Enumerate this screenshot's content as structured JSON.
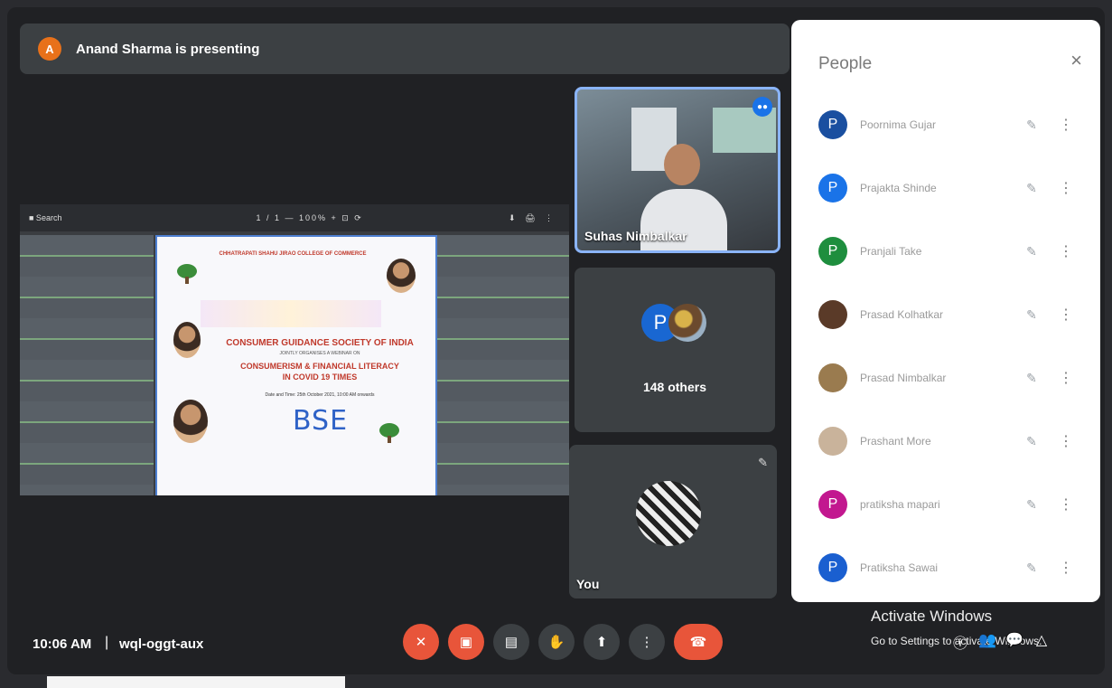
{
  "presenting": {
    "avatar_letter": "A",
    "text": "Anand Sharma is presenting"
  },
  "viewer_toolbar": {
    "left": "■  Search",
    "mid": "1 / 1  —  100%  +  ⊡  ⟳",
    "right": "⬇  🖨  ⋮"
  },
  "poster": {
    "college": "CHHATRAPATI SHAHU JIRAO COLLEGE OF COMMERCE",
    "society": "CONSUMER GUIDANCE SOCIETY OF INDIA",
    "organises": "JOINTLY ORGANISES A WEBINAR ON",
    "topic_line1": "CONSUMERISM & FINANCIAL LITERACY",
    "topic_line2": "IN COVID 19 TIMES",
    "datetime": "Date and Time: 25th October 2021, 10:00 AM onwards",
    "logo": "BSE"
  },
  "tiles": {
    "featured": {
      "name": "Suhas Nimbalkar",
      "display_name": "Suhas Nimbalkar"
    },
    "others": {
      "avatar_letter": "P",
      "count_label": "148 others"
    },
    "self": {
      "label": "You"
    }
  },
  "people_panel": {
    "title": "People",
    "close_icon": "×",
    "people": [
      {
        "name": "Poornima Gujar",
        "avatar_letter": "P",
        "avatar_color": "#1a4fa0"
      },
      {
        "name": "Prajakta Shinde",
        "avatar_letter": "P",
        "avatar_color": "#1a73e8"
      },
      {
        "name": "Pranjali Take",
        "avatar_letter": "P",
        "avatar_color": "#1e8e3e"
      },
      {
        "name": "Prasad Kolhatkar",
        "avatar_letter": "",
        "avatar_color": "#5a3a28"
      },
      {
        "name": "Prasad Nimbalkar",
        "avatar_letter": "",
        "avatar_color": "#9a7b4f"
      },
      {
        "name": "Prashant More",
        "avatar_letter": "",
        "avatar_color": "#c9b39b"
      },
      {
        "name": "pratiksha mapari",
        "avatar_letter": "P",
        "avatar_color": "#c2188f"
      },
      {
        "name": "Pratiksha Sawai",
        "avatar_letter": "P",
        "avatar_color": "#1a5fd0"
      }
    ]
  },
  "bottom_bar": {
    "time": "10:06 AM",
    "separator": "|",
    "meeting_code": "wql-oggt-aux",
    "controls": [
      "mic-off-icon",
      "camera-off-icon",
      "captions-icon",
      "raise-hand-icon",
      "present-icon",
      "more-options-icon",
      "end-call-icon"
    ]
  },
  "activate_windows": {
    "title": "Activate Windows",
    "subtitle": "Go to Settings to activate Windows."
  },
  "icons": {
    "mic_off": "✎",
    "more": "⋮",
    "hand": "✋",
    "info": "ⓘ",
    "people": "👥",
    "chat": "💬",
    "activities": "△"
  }
}
